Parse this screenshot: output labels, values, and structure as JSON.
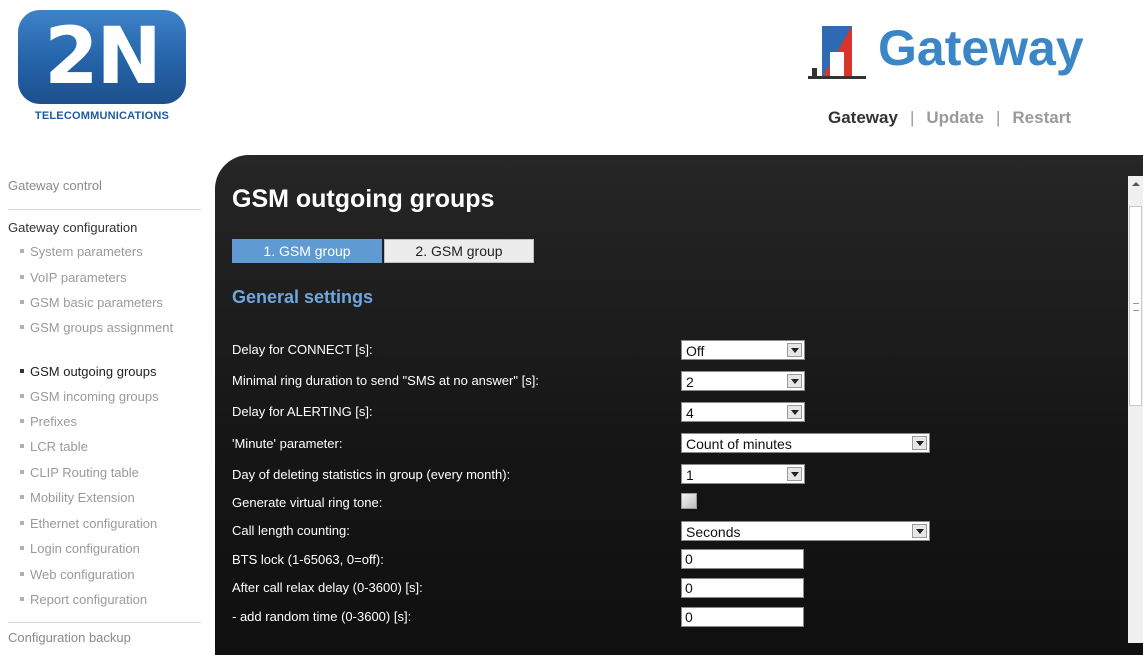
{
  "brand": {
    "logo_text": "2N",
    "logo_subtitle": "TELECOMMUNICATIONS",
    "product": "Gateway",
    "color_primary": "#2463a8",
    "color_accent": "#3a86c6"
  },
  "top_nav": {
    "items": [
      "Gateway",
      "Update",
      "Restart"
    ],
    "separator": "|",
    "active": "Gateway"
  },
  "sidebar": {
    "gateway_control": "Gateway control",
    "gateway_configuration": "Gateway configuration",
    "items": [
      "System parameters",
      "VoIP parameters",
      "GSM basic parameters",
      "GSM groups assignment",
      "GSM outgoing groups",
      "GSM incoming groups",
      "Prefixes",
      "LCR table",
      "CLIP Routing table",
      "Mobility Extension",
      "Ethernet configuration",
      "Login configuration",
      "Web configuration",
      "Report configuration"
    ],
    "current_item": "GSM outgoing groups",
    "configuration_backup": "Configuration backup"
  },
  "main": {
    "title": "GSM outgoing groups",
    "tabs": [
      {
        "label": "1. GSM group",
        "active": true
      },
      {
        "label": "2. GSM group",
        "active": false
      }
    ],
    "section_title": "General settings",
    "fields": {
      "delay_connect": {
        "label": "Delay for CONNECT [s]:",
        "value": "Off"
      },
      "min_ring": {
        "label": "Minimal ring duration to send \"SMS at no answer\" [s]:",
        "value": "2"
      },
      "delay_alerting": {
        "label": "Delay for ALERTING [s]:",
        "value": "4"
      },
      "minute_param": {
        "label": "'Minute' parameter:",
        "value": "Count of minutes"
      },
      "delete_stats_day": {
        "label": "Day of deleting statistics in group (every month):",
        "value": "1"
      },
      "virtual_ring": {
        "label": "Generate virtual ring tone:",
        "checked": false
      },
      "call_length": {
        "label": "Call length counting:",
        "value": "Seconds"
      },
      "bts_lock": {
        "label": "BTS lock (1-65063, 0=off):",
        "value": "0"
      },
      "relax_delay": {
        "label": "After call relax delay (0-3600) [s]:",
        "value": "0"
      },
      "random_time": {
        "label": "- add random time (0-3600) [s]:",
        "value": "0"
      }
    }
  }
}
